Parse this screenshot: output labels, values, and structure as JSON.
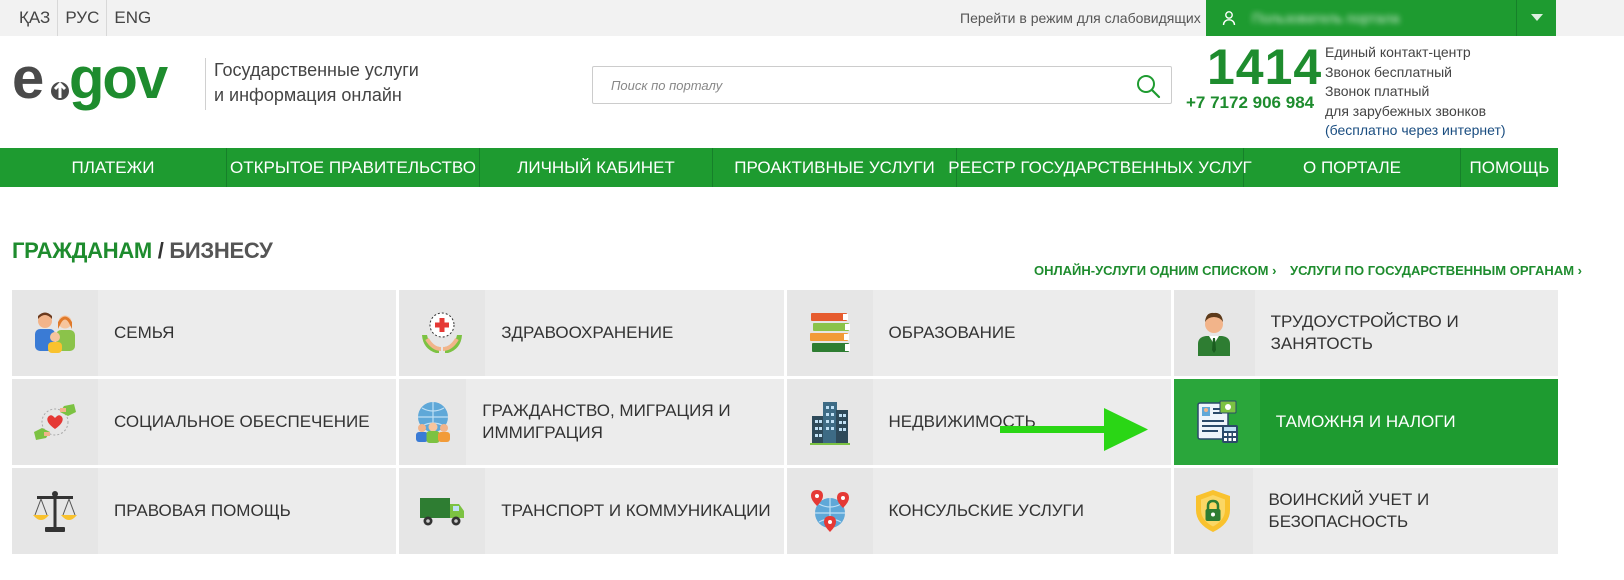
{
  "topbar": {
    "languages": [
      "ҚАЗ",
      "РУС",
      "ENG"
    ],
    "low_vision": "Перейти в режим для слабовидящих",
    "user_name": "Пользователь портала",
    "colors": {
      "brand": "#1e9b30",
      "text": "#1e8c2e",
      "link": "#1a4d80"
    }
  },
  "header": {
    "logo_text": "egov",
    "tagline_line1": "Государственные услуги",
    "tagline_line2": "и информация онлайн",
    "search_placeholder": "Поиск по порталу",
    "phone_short": "1414",
    "phone_long": "+7 7172 906 984",
    "contact_lines": [
      "Единый контакт-центр",
      "Звонок бесплатный",
      "Звонок платный",
      "для зарубежных звонков"
    ],
    "contact_link": "(бесплатно через интернет)"
  },
  "nav": [
    "ПЛАТЕЖИ",
    "ОТКРЫТОЕ ПРАВИТЕЛЬСТВО",
    "ЛИЧНЫЙ КАБИНЕТ",
    "ПРОАКТИВНЫЕ УСЛУГИ",
    "РЕЕСТР ГОСУДАРСТВЕННЫХ УСЛУГ",
    "О ПОРТАЛЕ",
    "ПОМОЩЬ"
  ],
  "section": {
    "title_citizens": "ГРАЖДАНАМ",
    "separator": "/",
    "title_business": "БИЗНЕСУ",
    "link_list": "ОНЛАЙН-УСЛУГИ ОДНИМ СПИСКОМ ›",
    "link_agencies": "УСЛУГИ ПО ГОСУДАРСТВЕННЫМ ОРГАНАМ ›"
  },
  "categories": [
    {
      "label": "СЕМЬЯ",
      "icon": "family-icon"
    },
    {
      "label": "ЗДРАВООХРАНЕНИЕ",
      "icon": "healthcare-icon"
    },
    {
      "label": "ОБРАЗОВАНИЕ",
      "icon": "books-icon"
    },
    {
      "label": "ТРУДОУСТРОЙСТВО И ЗАНЯТОСТЬ",
      "icon": "worker-icon"
    },
    {
      "label": "СОЦИАЛЬНОЕ ОБЕСПЕЧЕНИЕ",
      "icon": "social-care-icon"
    },
    {
      "label": "ГРАЖДАНСТВО, МИГРАЦИЯ И ИММИГРАЦИЯ",
      "icon": "globe-people-icon"
    },
    {
      "label": "НЕДВИЖИМОСТЬ",
      "icon": "buildings-icon"
    },
    {
      "label": "ТАМОЖНЯ И НАЛОГИ",
      "icon": "tax-document-icon",
      "active": true
    },
    {
      "label": "ПРАВОВАЯ ПОМОЩЬ",
      "icon": "scales-icon"
    },
    {
      "label": "ТРАНСПОРТ И КОММУНИКАЦИИ",
      "icon": "truck-icon"
    },
    {
      "label": "КОНСУЛЬСКИЕ УСЛУГИ",
      "icon": "globe-pins-icon"
    },
    {
      "label": "ВОИНСКИЙ УЧЕТ И БЕЗОПАСНОСТЬ",
      "icon": "shield-lock-icon"
    }
  ],
  "annotation": {
    "icon": "green-arrow-icon",
    "color": "#2ad615"
  }
}
